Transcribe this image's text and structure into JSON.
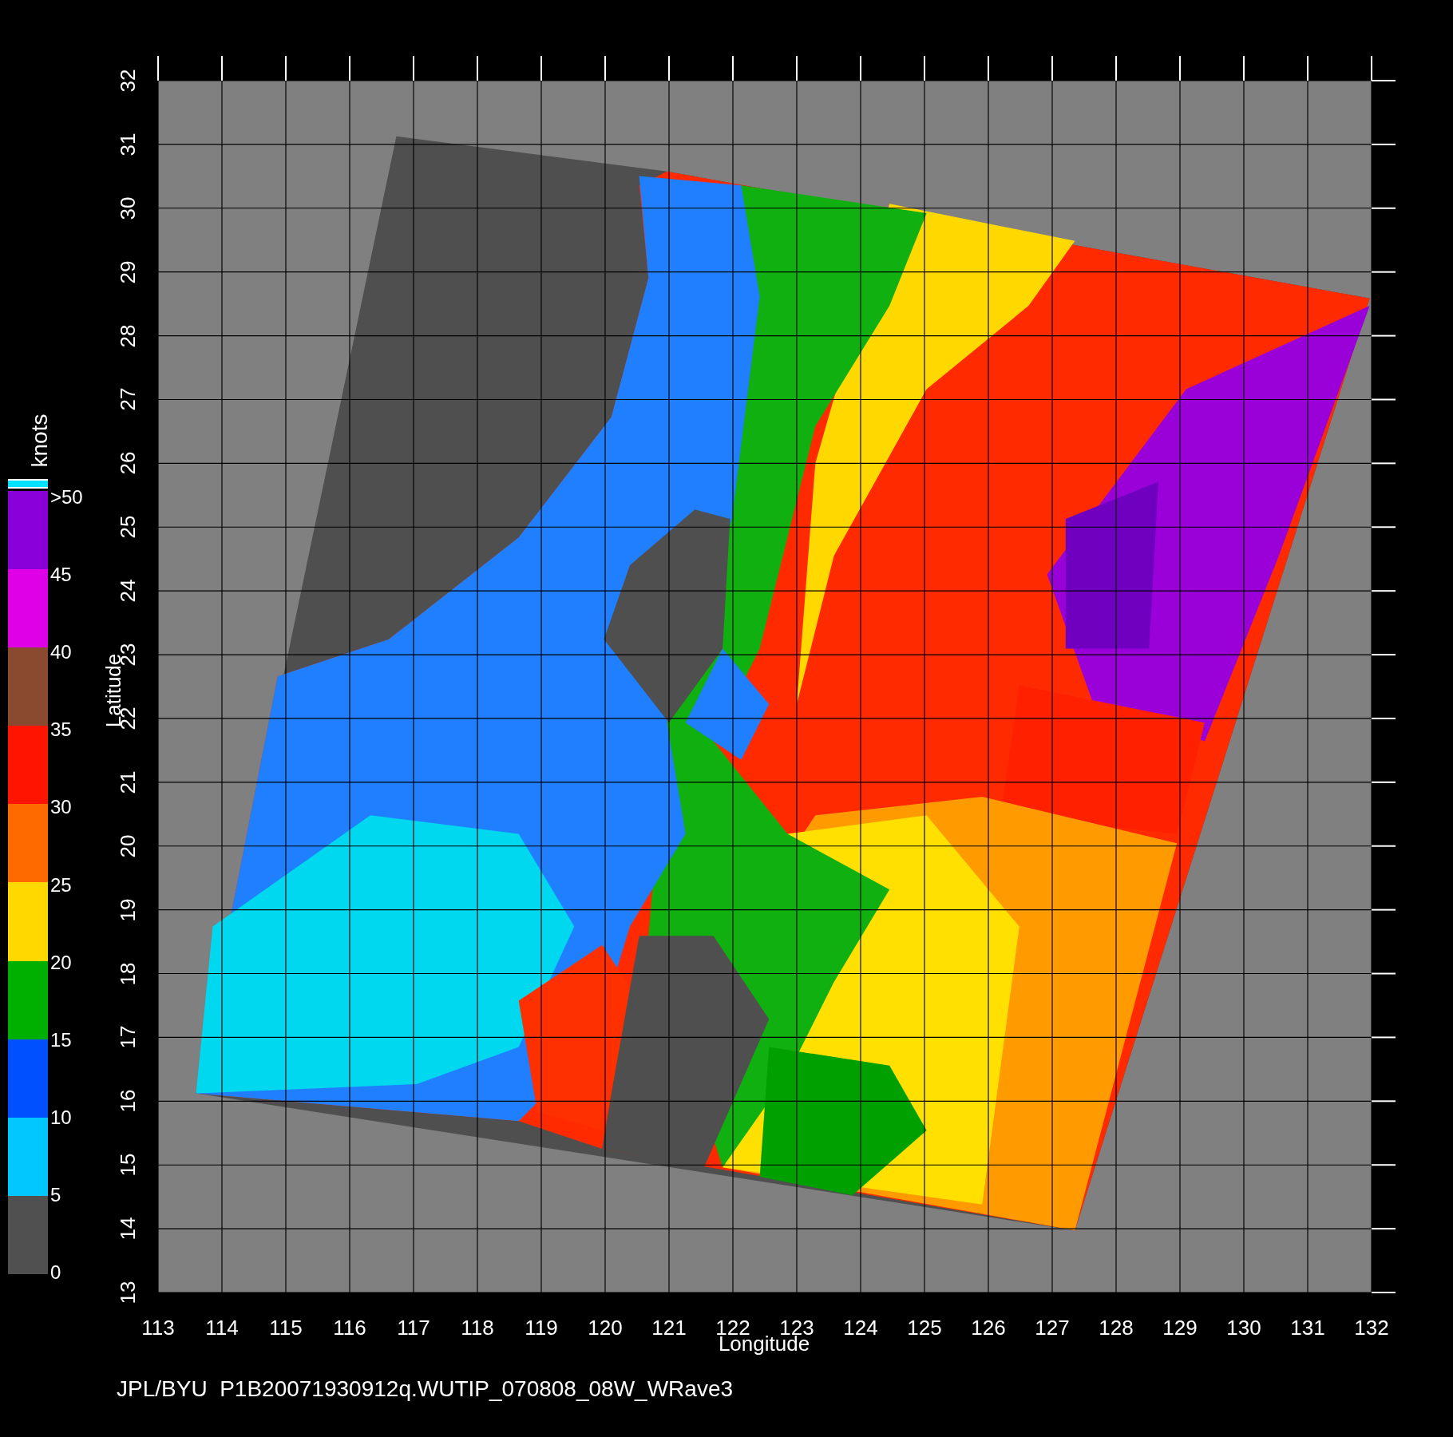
{
  "figure": {
    "x_axis": {
      "label": "Longitude",
      "ticks": [
        "113",
        "114",
        "115",
        "116",
        "117",
        "118",
        "119",
        "120",
        "121",
        "122",
        "123",
        "124",
        "125",
        "126",
        "127",
        "128",
        "129",
        "130",
        "131",
        "132"
      ]
    },
    "y_axis": {
      "label": "Latitude",
      "ticks": [
        "13",
        "14",
        "15",
        "16",
        "17",
        "18",
        "19",
        "20",
        "21",
        "22",
        "23",
        "24",
        "25",
        "26",
        "27",
        "28",
        "29",
        "30",
        "31",
        "32"
      ]
    },
    "colorbar": {
      "unit": "knots",
      "labels": [
        ">50",
        "45",
        "40",
        "35",
        "30",
        "25",
        "20",
        "15",
        "10",
        "5",
        "0"
      ],
      "segments": [
        {
          "color": "#8a00d8"
        },
        {
          "color": "#e000e8"
        },
        {
          "color": "#8a4a30"
        },
        {
          "color": "#ff1400"
        },
        {
          "color": "#ff6a00"
        },
        {
          "color": "#ffd800"
        },
        {
          "color": "#00b000"
        },
        {
          "color": "#0050ff"
        },
        {
          "color": "#00c8ff"
        },
        {
          "color": "#505050"
        }
      ]
    },
    "caption": "JPL/BYU  P1B20071930912q.WUTIP_070808_08W_WRave3"
  }
}
